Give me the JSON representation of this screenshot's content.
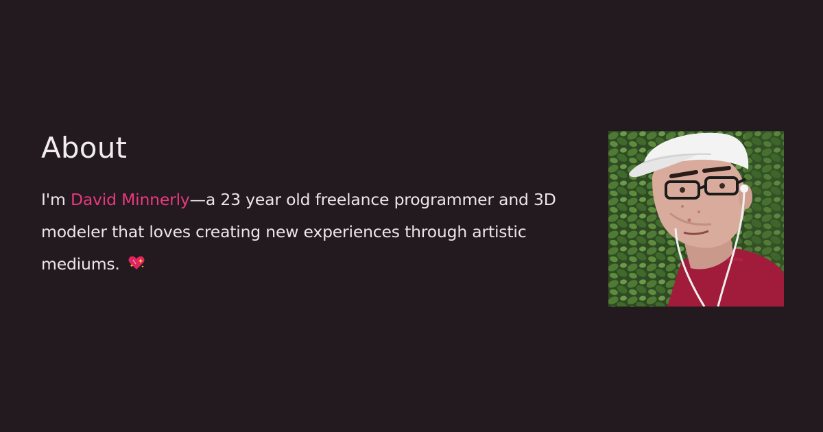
{
  "about": {
    "heading": "About",
    "bio_prefix": "I'm ",
    "name": "David Minnerly",
    "bio_suffix": "—a 23 year old freelance programmer and 3D modeler that loves creating new experiences through artistic mediums.",
    "heart_icon": "sparkling-heart-icon",
    "accent_color": "#e8397d",
    "background_color": "#221a1e"
  },
  "portrait": {
    "icon": "profile-photo"
  }
}
